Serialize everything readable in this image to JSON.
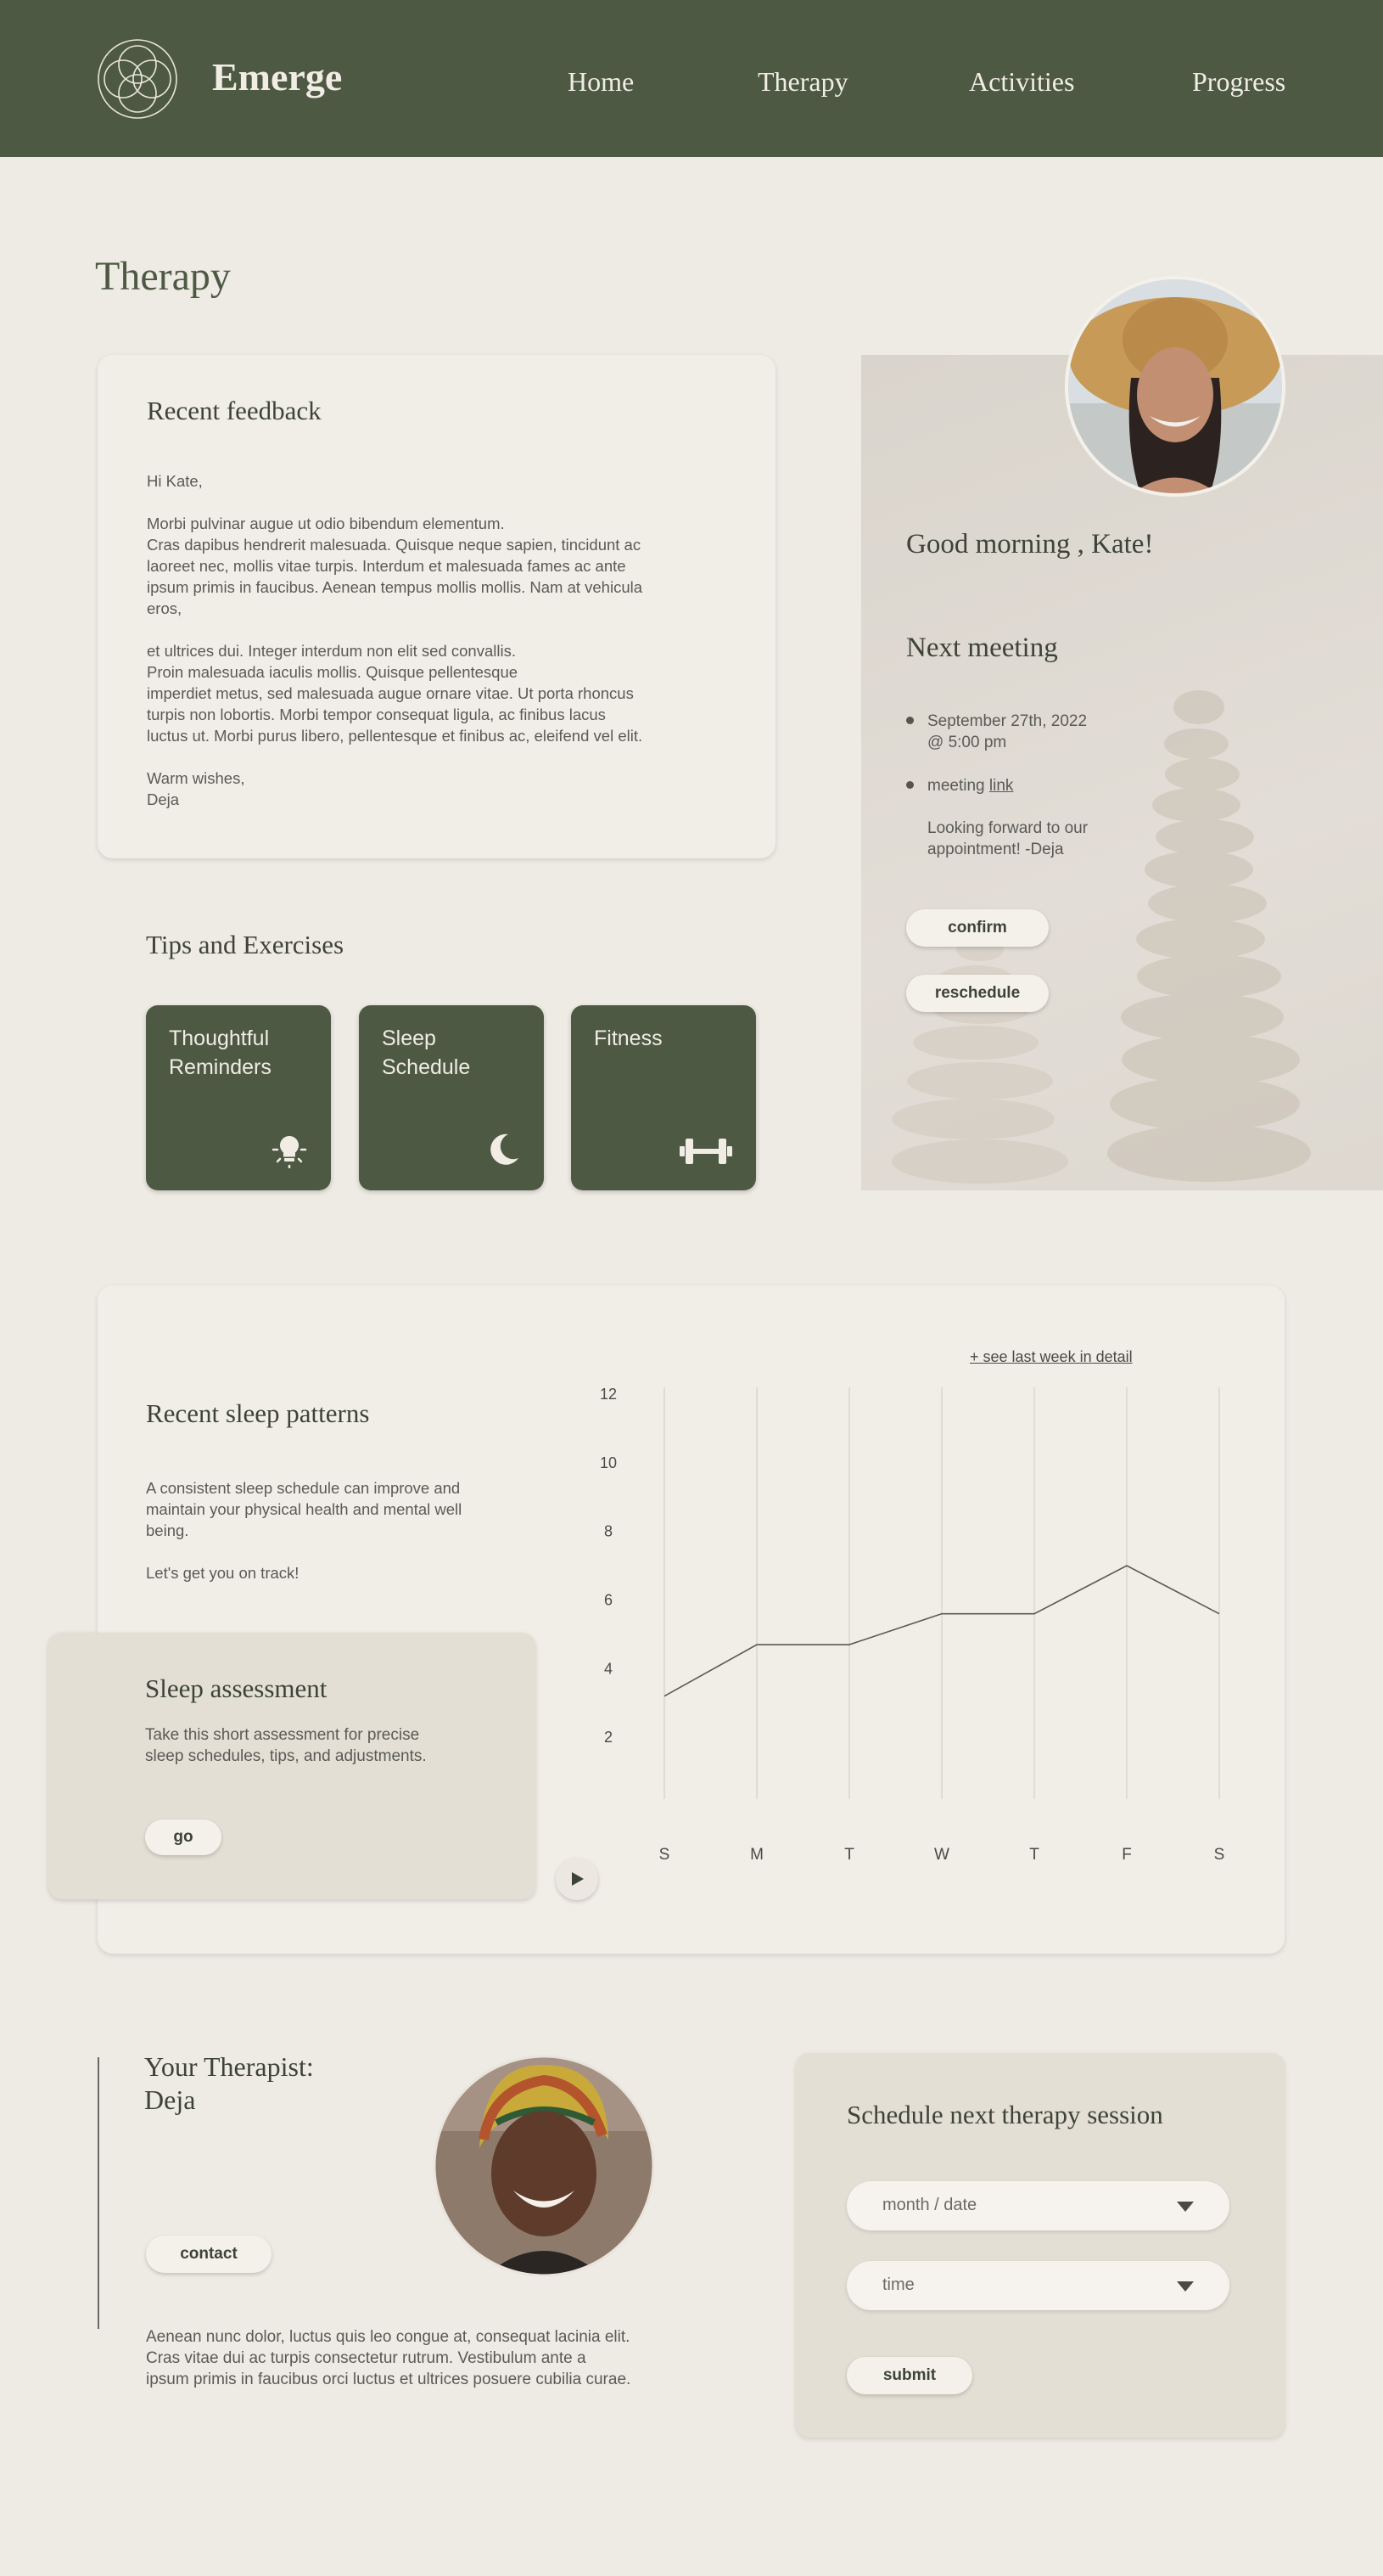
{
  "header": {
    "brand": "Emerge",
    "nav": [
      {
        "label": "Home"
      },
      {
        "label": "Therapy"
      },
      {
        "label": "Activities"
      },
      {
        "label": "Progress"
      }
    ]
  },
  "page_title": "Therapy",
  "feedback": {
    "title": "Recent feedback",
    "greeting": "Hi Kate,",
    "para1": "Morbi pulvinar augue ut odio bibendum elementum.\nCras dapibus hendrerit malesuada. Quisque neque sapien, tincidunt ac\nlaoreet nec, mollis vitae turpis. Interdum et malesuada fames ac ante\nipsum primis in faucibus. Aenean tempus mollis mollis. Nam at vehicula\neros,",
    "para2": "et ultrices dui. Integer interdum non elit sed convallis.\nProin malesuada iaculis mollis. Quisque pellentesque\nimperdiet metus, sed malesuada augue ornare vitae. Ut porta rhoncus\nturpis non lobortis. Morbi tempor consequat ligula, ac finibus lacus\nluctus ut. Morbi purus libero, pellentesque et finibus ac, eleifend vel elit.",
    "signoff": "Warm wishes,\nDeja"
  },
  "tips": {
    "title": "Tips and Exercises",
    "tiles": [
      {
        "label": "Thoughtful Reminders",
        "icon": "lightbulb-icon"
      },
      {
        "label": "Sleep Schedule",
        "icon": "moon-icon"
      },
      {
        "label": "Fitness",
        "icon": "dumbbell-icon"
      }
    ]
  },
  "welcome": {
    "greeting": "Good morning , Kate!",
    "next_meeting_title": "Next meeting",
    "date_line": "September 27th, 2022\n@ 5:00 pm",
    "meeting_prefix": "meeting ",
    "meeting_link": "link",
    "note": "Looking forward to our\nappointment!   -Deja",
    "confirm": "confirm",
    "reschedule": "reschedule"
  },
  "sleep": {
    "see_last_week": "+ see last week in detail",
    "title": "Recent sleep patterns",
    "desc": "A consistent sleep schedule can improve and\nmaintain your physical health and mental well\nbeing.",
    "cta": "Let's get you on track!",
    "assessment_title": "Sleep assessment",
    "assessment_desc": "Take this short assessment for precise\nsleep schedules, tips, and adjustments.",
    "go": "go"
  },
  "chart_data": {
    "type": "line",
    "categories": [
      "S",
      "M",
      "T",
      "W",
      "T",
      "F",
      "S"
    ],
    "values": [
      3.2,
      4.7,
      4.7,
      5.6,
      5.6,
      7.0,
      5.6
    ],
    "ylim": [
      0,
      12
    ],
    "yticks": [
      2,
      4,
      6,
      8,
      10,
      12
    ],
    "grid": "vertical"
  },
  "therapist": {
    "title": "Your Therapist:",
    "name": "Deja",
    "contact": "contact",
    "bio": "Aenean nunc dolor, luctus quis leo congue at, consequat lacinia elit.\nCras vitae dui ac turpis consectetur rutrum. Vestibulum ante a\nipsum primis in faucibus orci luctus et ultrices posuere cubilia curae."
  },
  "schedule": {
    "title": "Schedule next therapy session",
    "date_placeholder": "month / date",
    "time_placeholder": "time",
    "submit": "submit"
  },
  "colors": {
    "brand_green": "#4d5943",
    "background": "#eeeae4",
    "card": "#f1eee8",
    "panel": "#e3dfd5"
  }
}
